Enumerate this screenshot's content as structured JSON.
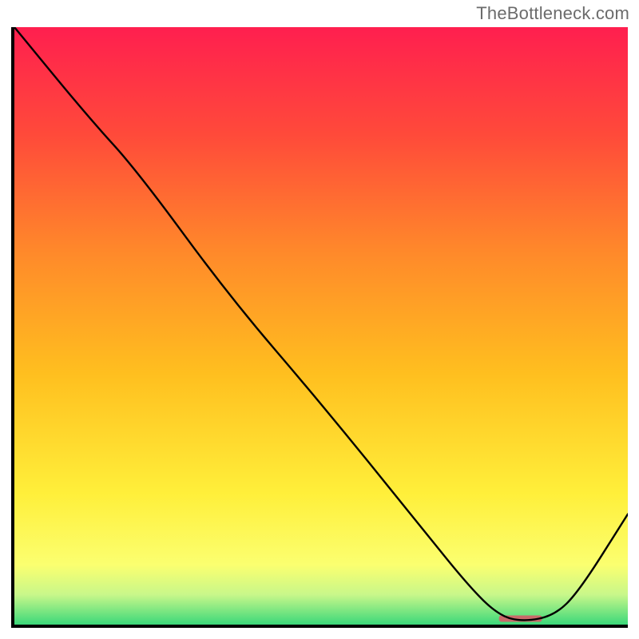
{
  "attribution": "TheBottleneck.com",
  "chart_data": {
    "type": "line",
    "title": "",
    "xlabel": "",
    "ylabel": "",
    "xlim": [
      0,
      100
    ],
    "ylim": [
      0,
      100
    ],
    "grid": false,
    "series": [
      {
        "name": "curve",
        "x": [
          0,
          12,
          20,
          35,
          50,
          65,
          74,
          79,
          83,
          88,
          92,
          100
        ],
        "values": [
          100,
          85,
          76,
          55,
          37,
          18,
          6.5,
          1.5,
          0.5,
          1.5,
          5.5,
          18.5
        ]
      }
    ],
    "marker": {
      "name": "highlighted-segment",
      "x_start": 79,
      "x_end": 86,
      "y": 1.0,
      "color": "#c96a6a"
    },
    "background_gradient": {
      "stops": [
        {
          "offset": 0.0,
          "color": "#ff1f4f"
        },
        {
          "offset": 0.18,
          "color": "#ff4a3a"
        },
        {
          "offset": 0.38,
          "color": "#ff8a2a"
        },
        {
          "offset": 0.58,
          "color": "#ffbf1f"
        },
        {
          "offset": 0.78,
          "color": "#ffef3a"
        },
        {
          "offset": 0.9,
          "color": "#fbff70"
        },
        {
          "offset": 0.95,
          "color": "#c8f78a"
        },
        {
          "offset": 1.0,
          "color": "#3bd87a"
        }
      ]
    }
  }
}
